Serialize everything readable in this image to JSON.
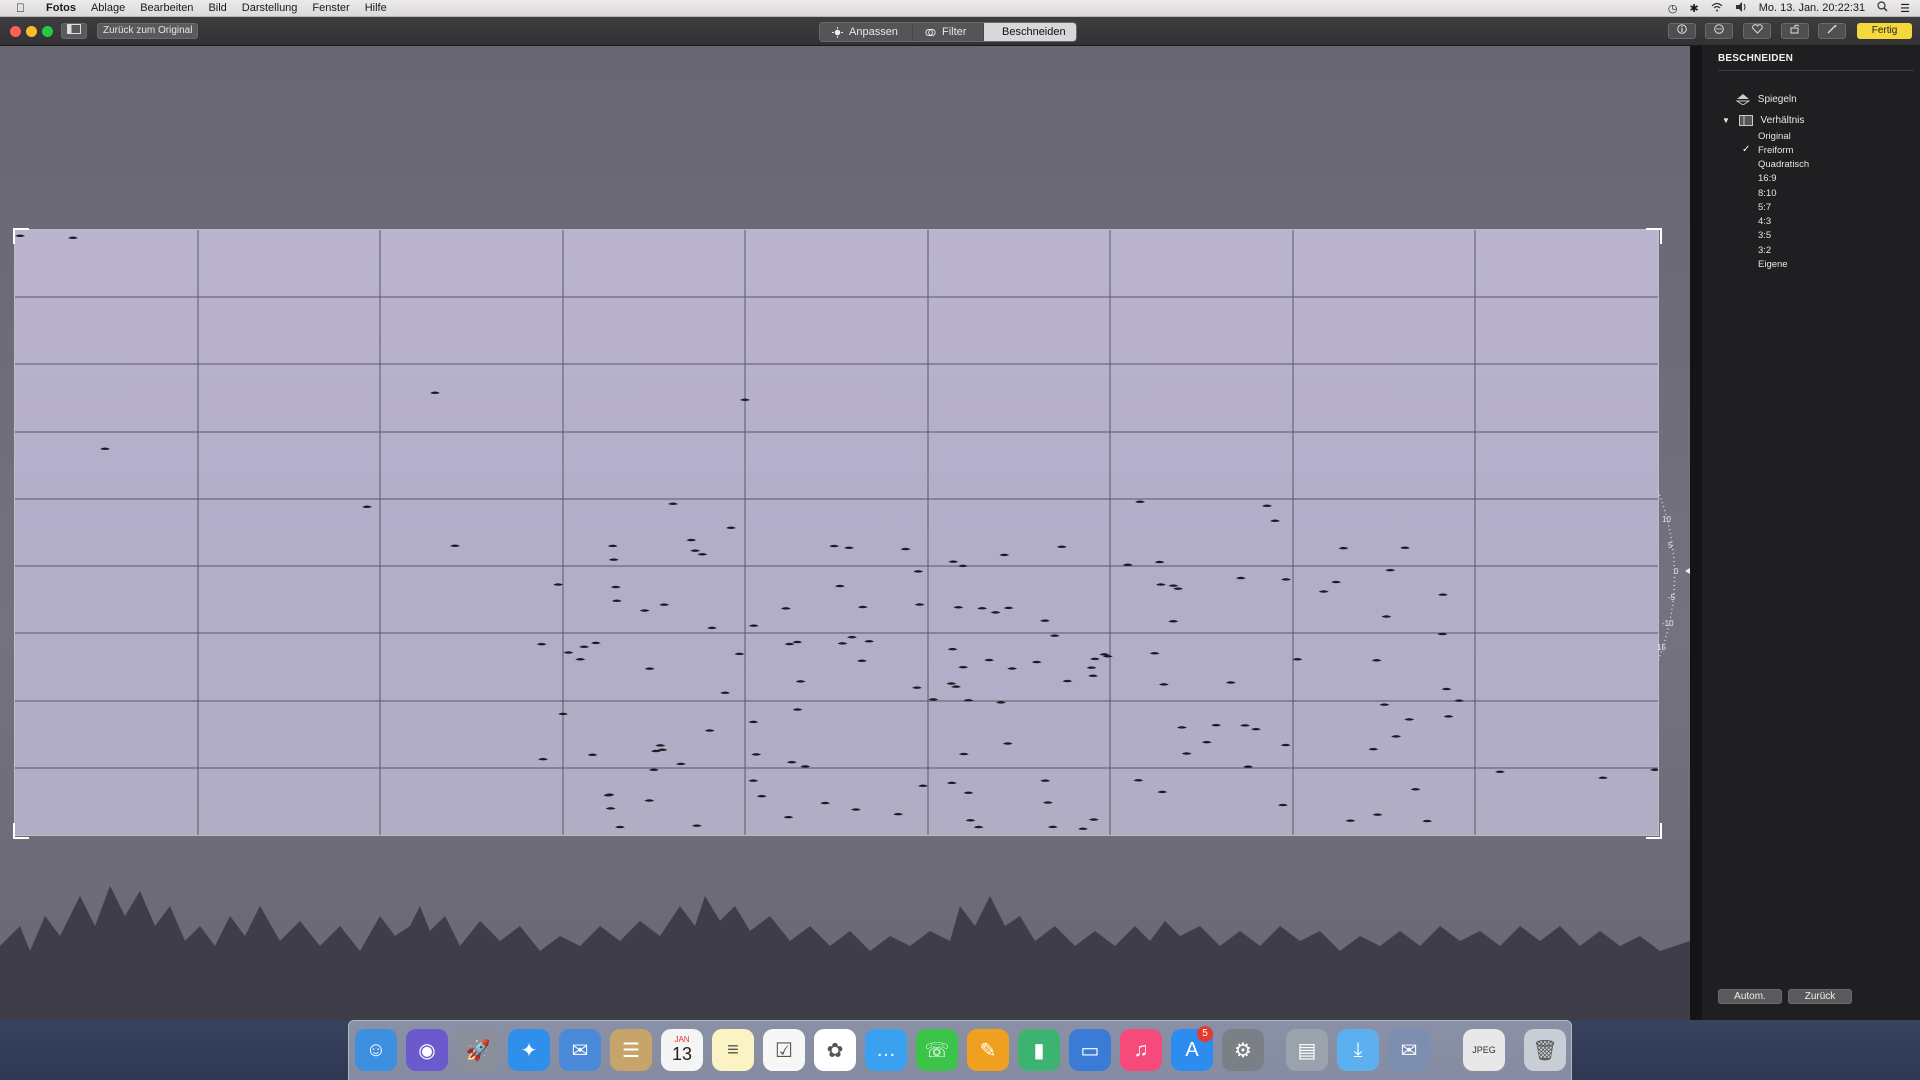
{
  "menubar": {
    "app_name": "Fotos",
    "items": [
      "Ablage",
      "Bearbeiten",
      "Bild",
      "Darstellung",
      "Fenster",
      "Hilfe"
    ],
    "clock": "Mo. 13. Jan. 20:22:31"
  },
  "toolbar": {
    "revert_label": "Zurück zum Original",
    "tabs": [
      {
        "label": "Anpassen",
        "icon": "adjust-icon",
        "active": false
      },
      {
        "label": "Filter",
        "icon": "filter-icon",
        "active": false
      },
      {
        "label": "Beschneiden",
        "icon": "crop-icon",
        "active": true
      }
    ],
    "done_label": "Fertig",
    "done_color": "#f5d93c"
  },
  "straighten_dial": {
    "ticks": [
      "10",
      "5",
      "0",
      "-5",
      "-10",
      "15"
    ]
  },
  "panel": {
    "title": "BESCHNEIDEN",
    "flip_label": "Spiegeln",
    "ratio_label": "Verhältnis",
    "ratios": [
      "Original",
      "Freiform",
      "Quadratisch",
      "16:9",
      "8:10",
      "5:7",
      "4:3",
      "3:5",
      "3:2",
      "Eigene"
    ],
    "selected_ratio": "Freiform",
    "auto_label": "Autom.",
    "back_label": "Zurück"
  },
  "dock": {
    "calendar_month": "JAN",
    "calendar_day": "13",
    "appstore_badge": "5",
    "apps": [
      "Finder",
      "Siri",
      "Launchpad",
      "Safari",
      "Mail",
      "Kontakte",
      "Kalender",
      "Notizen",
      "Erinnerungen",
      "Fotos",
      "Nachrichten",
      "FaceTime",
      "Pages",
      "Numbers",
      "Keynote",
      "iTunes",
      "App Store",
      "Systemeinstellungen",
      "Festplattendienstprogramm",
      "Vorschau-Downloads",
      "Vorschau",
      "JPEG-Datei",
      "Papierkorb"
    ],
    "jpeg_label": "JPEG"
  }
}
